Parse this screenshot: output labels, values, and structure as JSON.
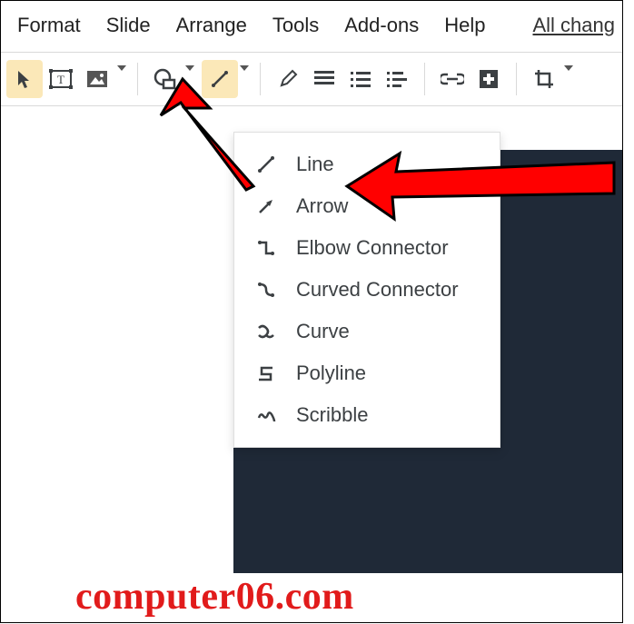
{
  "menu": {
    "items": [
      "Format",
      "Slide",
      "Arrange",
      "Tools",
      "Add-ons",
      "Help"
    ],
    "all_changes": "All chang"
  },
  "toolbar": {
    "select": "select",
    "textbox": "textbox",
    "image": "image",
    "shape": "shape",
    "line": "line",
    "pen": "pen",
    "align": "align",
    "list": "list",
    "linelist": "linelist",
    "link": "link",
    "add": "add",
    "crop": "crop"
  },
  "dropdown": {
    "items": [
      {
        "icon": "line-icon",
        "label": "Line"
      },
      {
        "icon": "arrow-icon",
        "label": "Arrow"
      },
      {
        "icon": "elbow-icon",
        "label": "Elbow Connector"
      },
      {
        "icon": "curved-connector-icon",
        "label": "Curved Connector"
      },
      {
        "icon": "curve-icon",
        "label": "Curve"
      },
      {
        "icon": "polyline-icon",
        "label": "Polyline"
      },
      {
        "icon": "scribble-icon",
        "label": "Scribble"
      }
    ]
  },
  "watermark": "computer06.com"
}
